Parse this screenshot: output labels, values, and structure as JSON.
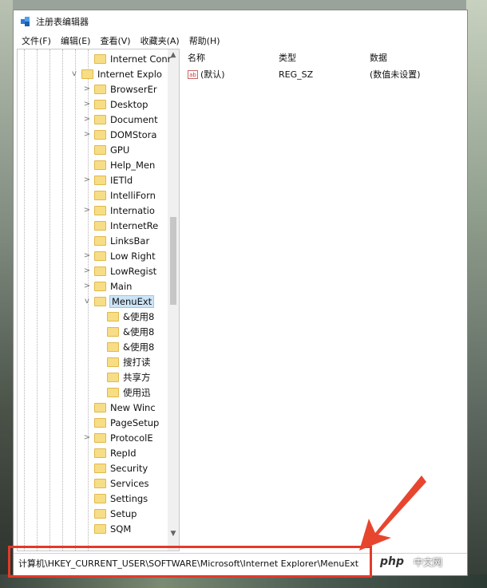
{
  "window": {
    "title": "注册表编辑器"
  },
  "menu": [
    "文件(F)",
    "编辑(E)",
    "查看(V)",
    "收藏夹(A)",
    "帮助(H)"
  ],
  "tree": {
    "items": [
      {
        "label": "Internet Conr",
        "expander": "",
        "selected": false
      },
      {
        "label": "Internet Explo",
        "expander": "v",
        "selected": false
      },
      {
        "label": "BrowserEr",
        "expander": ">",
        "selected": false
      },
      {
        "label": "Desktop",
        "expander": ">",
        "selected": false
      },
      {
        "label": "Document",
        "expander": ">",
        "selected": false
      },
      {
        "label": "DOMStora",
        "expander": ">",
        "selected": false
      },
      {
        "label": "GPU",
        "expander": "",
        "selected": false
      },
      {
        "label": "Help_Men",
        "expander": "",
        "selected": false
      },
      {
        "label": "IETld",
        "expander": ">",
        "selected": false
      },
      {
        "label": "IntelliForn",
        "expander": "",
        "selected": false
      },
      {
        "label": "Internatio",
        "expander": ">",
        "selected": false
      },
      {
        "label": "InternetRe",
        "expander": "",
        "selected": false
      },
      {
        "label": "LinksBar",
        "expander": "",
        "selected": false
      },
      {
        "label": "Low Right",
        "expander": ">",
        "selected": false
      },
      {
        "label": "LowRegist",
        "expander": ">",
        "selected": false
      },
      {
        "label": "Main",
        "expander": ">",
        "selected": false
      },
      {
        "label": "MenuExt",
        "expander": "v",
        "selected": true
      },
      {
        "label": "&使用8",
        "expander": "",
        "selected": false
      },
      {
        "label": "&使用8",
        "expander": "",
        "selected": false
      },
      {
        "label": "&使用8",
        "expander": "",
        "selected": false
      },
      {
        "label": "搜打读",
        "expander": "",
        "selected": false
      },
      {
        "label": "共享方",
        "expander": "",
        "selected": false
      },
      {
        "label": "使用迅",
        "expander": "",
        "selected": false
      },
      {
        "label": "New Winc",
        "expander": "",
        "selected": false
      },
      {
        "label": "PageSetup",
        "expander": "",
        "selected": false
      },
      {
        "label": "ProtocolE",
        "expander": ">",
        "selected": false
      },
      {
        "label": "RepId",
        "expander": "",
        "selected": false
      },
      {
        "label": "Security",
        "expander": "",
        "selected": false
      },
      {
        "label": "Services",
        "expander": "",
        "selected": false
      },
      {
        "label": "Settings",
        "expander": "",
        "selected": false
      },
      {
        "label": "Setup",
        "expander": "",
        "selected": false
      },
      {
        "label": "SQM",
        "expander": "",
        "selected": false
      }
    ]
  },
  "values": {
    "headers": [
      "名称",
      "类型",
      "数据"
    ],
    "rows": [
      {
        "icon": "ab",
        "name": "(默认)",
        "type": "REG_SZ",
        "data": "(数值未设置)"
      }
    ]
  },
  "status": {
    "path": "计算机\\HKEY_CURRENT_USER\\SOFTWARE\\Microsoft\\Internet Explorer\\MenuExt"
  },
  "watermark": {
    "logo": "php",
    "text": "中文网"
  },
  "colors": {
    "highlight": "#e23a2a",
    "selection": "#cce4f7",
    "folder": "#f7dd86"
  }
}
